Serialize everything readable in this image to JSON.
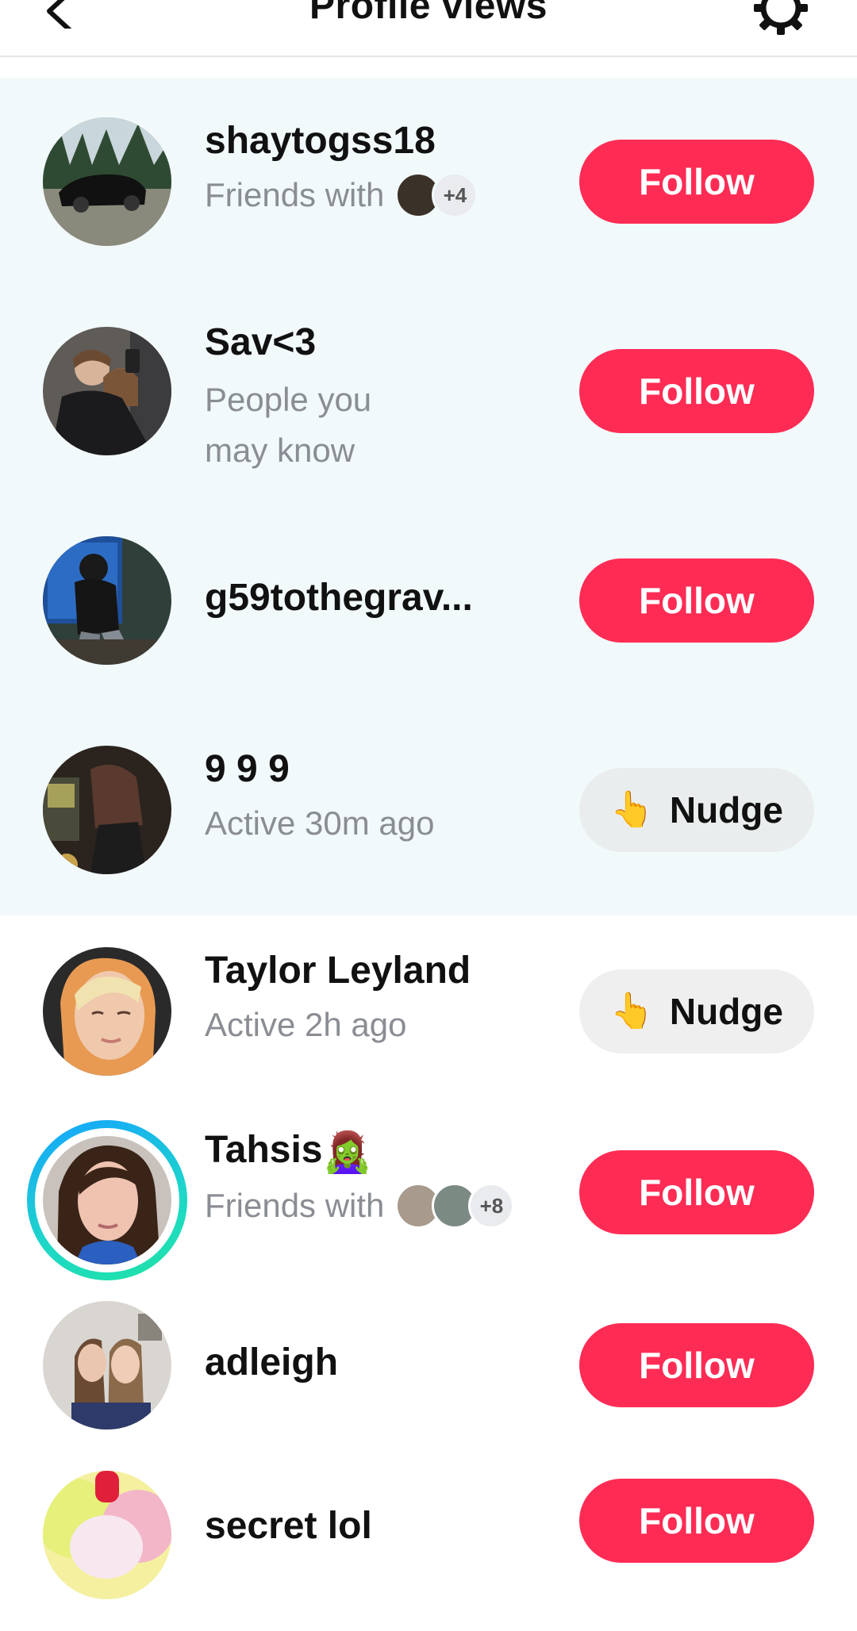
{
  "header": {
    "title": "Profile views"
  },
  "rows": [
    {
      "username": "shaytogss18",
      "sub": "Friends with",
      "more": "+4",
      "action": "Follow"
    },
    {
      "username": "Sav<3",
      "sub": "People you may know",
      "action": "Follow"
    },
    {
      "username": "g59tothegrav...",
      "action": "Follow"
    },
    {
      "username": "9 9 9",
      "sub": "Active 30m ago",
      "action": "Nudge"
    },
    {
      "username": "Taylor Leyland",
      "sub": "Active 2h ago",
      "action": "Nudge"
    },
    {
      "username": "Tahsis",
      "username_emoji": "🧟‍♀️",
      "sub": "Friends with",
      "more": "+8",
      "action": "Follow"
    },
    {
      "username": "adleigh",
      "action": "Follow"
    },
    {
      "username": "secret lol",
      "action": "Follow"
    }
  ],
  "icons": {
    "nudge": "👆"
  },
  "colors": {
    "follow": "#fe2c55",
    "highlight_bg": "#f2f9fb",
    "nudge_bg": "#eaedee",
    "secondary_text": "#8a8d93"
  }
}
